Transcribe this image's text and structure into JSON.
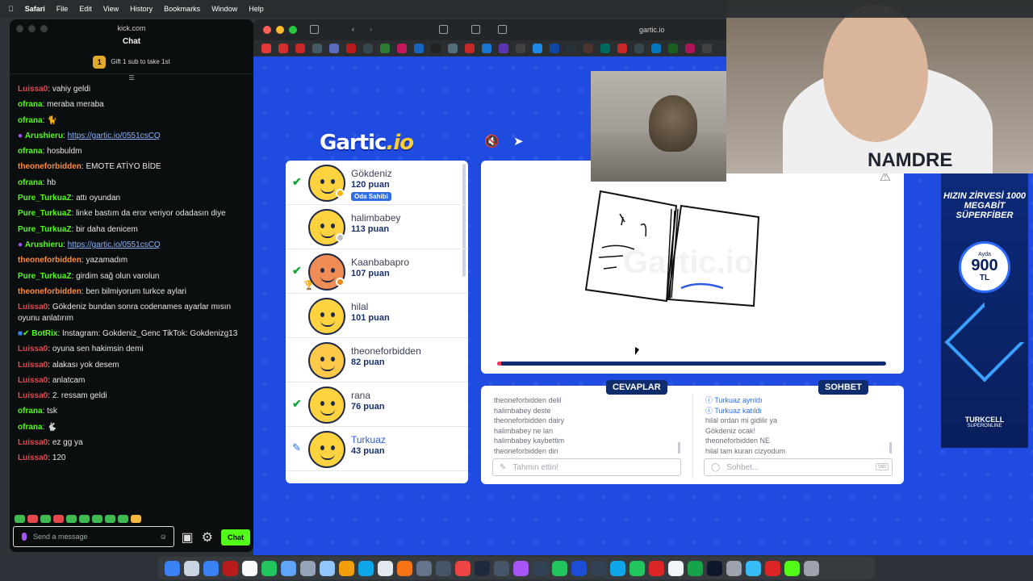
{
  "menubar": {
    "app": "Safari",
    "items": [
      "File",
      "Edit",
      "View",
      "History",
      "Bookmarks",
      "Window",
      "Help"
    ]
  },
  "chat_window": {
    "url": "kick.com",
    "title": "Chat",
    "gift_text": "Gift 1 sub to take 1st",
    "gift_badge": "1",
    "input_placeholder": "Send a message",
    "send_label": "Chat",
    "messages": [
      {
        "user": "Luissa0",
        "text": "vahiy geldi"
      },
      {
        "user": "ofrana",
        "text": "meraba meraba"
      },
      {
        "user": "ofrana",
        "text": ""
      },
      {
        "user": "Arushieru",
        "text": "https://gartic.io/0551csCQ"
      },
      {
        "user": "ofrana",
        "text": "hosbuldm"
      },
      {
        "user": "theoneforbidden",
        "text": "EMOTE ATİYO BİDE"
      },
      {
        "user": "ofrana",
        "text": "hb"
      },
      {
        "user": "Pure_TurkuaZ",
        "text": "attı oyundan"
      },
      {
        "user": "Pure_TurkuaZ",
        "text": "linke bastım da eror veriyor odadasın diye"
      },
      {
        "user": "Pure_TurkuaZ",
        "text": "bir daha denicem"
      },
      {
        "user": "Arushieru",
        "text": "https://gartic.io/0551csCQ"
      },
      {
        "user": "theoneforbidden",
        "text": "yazamadım"
      },
      {
        "user": "Pure_TurkuaZ",
        "text": "girdim sağ olun varolun"
      },
      {
        "user": "theoneforbidden",
        "text": "ben bilmiyorum turkce aylari"
      },
      {
        "user": "Luissa0",
        "text": "Gökdeniz bundan sonra codenames ayarlar mısın oyunu anlatırım"
      },
      {
        "user": "BotRix",
        "text": "Instagram: Gokdeniz_Genc TikTok: Gokdenizg13"
      },
      {
        "user": "Luissa0",
        "text": "oyuna sen hakimsin demi"
      },
      {
        "user": "Luissa0",
        "text": "alakası yok desem"
      },
      {
        "user": "Luissa0",
        "text": "anlatcam"
      },
      {
        "user": "Luissa0",
        "text": "2. ressam geldi"
      },
      {
        "user": "ofrana",
        "text": "tsk"
      },
      {
        "user": "ofrana",
        "text": ""
      },
      {
        "user": "Luissa0",
        "text": "ez gg ya"
      },
      {
        "user": "Luissa0",
        "text": "120"
      }
    ]
  },
  "browser": {
    "address": "gartic.io"
  },
  "game": {
    "logo_main": "Gartic",
    "logo_suffix": ".io",
    "players": [
      {
        "name": "Gökdeniz",
        "points": "120 puan",
        "badge": "Oda Sahibi",
        "status": "check"
      },
      {
        "name": "halimbabey",
        "points": "113 puan",
        "status": "none"
      },
      {
        "name": "Kaanbabapro",
        "points": "107 puan",
        "status": "check"
      },
      {
        "name": "hilal",
        "points": "101 puan",
        "status": "none"
      },
      {
        "name": "theoneforbidden",
        "points": "82 puan",
        "status": "none"
      },
      {
        "name": "rana",
        "points": "76 puan",
        "status": "check"
      },
      {
        "name": "Turkuaz",
        "points": "43 puan",
        "status": "drawing"
      }
    ],
    "canvas_watermark": "Gartic.io",
    "answers_tab": "CEVAPLAR",
    "chat_tab": "SOHBET",
    "answers": [
      {
        "user": "theoneforbidden",
        "text": "delil"
      },
      {
        "user": "halimbabey",
        "text": "deste"
      },
      {
        "user": "theoneforbidden",
        "text": "dairy"
      },
      {
        "user": "halimbabey",
        "text": "ne lan"
      },
      {
        "user": "halimbabey",
        "text": "kaybettim"
      },
      {
        "user": "theoneforbidden",
        "text": "din"
      }
    ],
    "chat_lines": [
      {
        "text": "Turkuaz ayrıldı",
        "type": "system"
      },
      {
        "text": "Turkuaz katıldı",
        "type": "system"
      },
      {
        "text": "hilal ordan mi gidilir ya",
        "type": "msg"
      },
      {
        "text": "Gökdeniz ocak!",
        "type": "msg"
      },
      {
        "text": "theoneforbidden NE",
        "type": "msg"
      },
      {
        "text": "hilal tam kuran cizyodum",
        "type": "msg"
      }
    ],
    "guess_placeholder": "Tahmin ettin!",
    "chat_placeholder": "Sohbet...",
    "tab_key": "tab",
    "progress": 0.01
  },
  "webcam": {
    "hoodie_text": "NAMDRE"
  },
  "ad": {
    "headline": "HIZIN ZİRVESİ 1000 MEGABİT SÜPERFİBER",
    "price_prefix": "Ayda",
    "price": "900",
    "currency": "TL",
    "brand": "TURKCELL",
    "brand_sub": "SUPERONLINE"
  }
}
